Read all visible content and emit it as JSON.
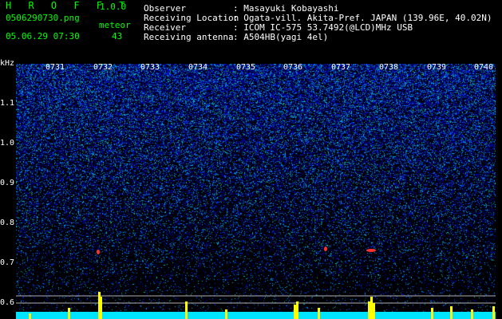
{
  "app": {
    "name": "H R O F F T",
    "version": "1.0.0"
  },
  "file": {
    "name": "0506290730.png",
    "datetime": "05.06.29 07:30"
  },
  "counter": {
    "label": "meteor",
    "value": "43"
  },
  "info": [
    {
      "key": "Observer",
      "value": ": Masayuki Kobayashi"
    },
    {
      "key": "Receiving Location",
      "value": ": Ogata-vill. Akita-Pref. JAPAN (139.96E, 40.02N)"
    },
    {
      "key": "Receiver",
      "value": ": ICOM IC-575 53.7492(@LCD)MHz USB"
    },
    {
      "key": "Receiving antenna",
      "value": ": A504HB(yagi 4el)"
    }
  ],
  "y_axis": {
    "unit": "kHz",
    "ticks": [
      "1.1",
      "1.0",
      "0.9",
      "0.8",
      "0.7",
      "0.6"
    ]
  },
  "x_axis": {
    "ticks": [
      "0731",
      "0732",
      "0733",
      "0734",
      "0735",
      "0736",
      "0737",
      "0738",
      "0739",
      "0740"
    ]
  },
  "colors": {
    "header_green": "#00ff00",
    "label_white": "#ffffff",
    "baseline_cyan": "#00e5ff",
    "spike_yellow": "#ffff00"
  }
}
